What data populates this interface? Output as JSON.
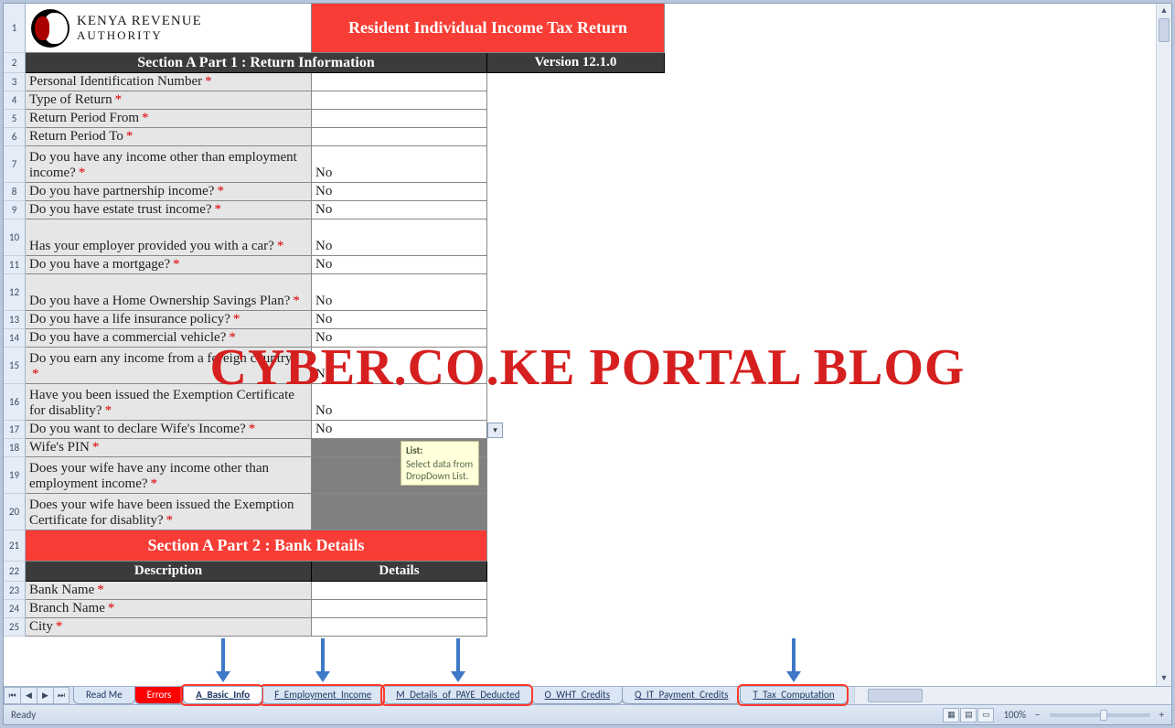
{
  "logo": {
    "line1": "KENYA REVENUE",
    "line2": "AUTHORITY"
  },
  "title": "Resident Individual Income Tax Return",
  "sectionA1": "Section A Part 1 : Return Information",
  "version": "Version 12.1.0",
  "rows": [
    {
      "n": 3,
      "label": "Personal Identification Number",
      "req": true,
      "val": "",
      "h": 20
    },
    {
      "n": 4,
      "label": "Type of Return",
      "req": true,
      "val": "",
      "h": 20
    },
    {
      "n": 5,
      "label": "Return Period From",
      "req": true,
      "val": "",
      "h": 20
    },
    {
      "n": 6,
      "label": "Return Period To",
      "req": true,
      "val": "",
      "h": 20
    },
    {
      "n": 7,
      "label": "Do you have any income other than employment income?",
      "req": true,
      "val": "No",
      "h": 40
    },
    {
      "n": 8,
      "label": "Do you have partnership income?",
      "req": true,
      "val": "No",
      "h": 20
    },
    {
      "n": 9,
      "label": "Do you have estate trust income?",
      "req": true,
      "val": "No",
      "h": 20
    },
    {
      "n": 10,
      "label": "Has your employer provided you with a car?",
      "req": true,
      "val": "No",
      "h": 40
    },
    {
      "n": 11,
      "label": "Do you have a mortgage?",
      "req": true,
      "val": "No",
      "h": 20
    },
    {
      "n": 12,
      "label": "Do you have a Home Ownership Savings Plan?",
      "req": true,
      "val": "No",
      "h": 40
    },
    {
      "n": 13,
      "label": "Do you have a life insurance policy?",
      "req": true,
      "val": "No",
      "h": 20
    },
    {
      "n": 14,
      "label": "Do you have a commercial vehicle?",
      "req": true,
      "val": "No",
      "h": 20
    },
    {
      "n": 15,
      "label": "Do you earn any income from a foreign country?",
      "req": true,
      "val": "No",
      "h": 40
    },
    {
      "n": 16,
      "label": "Have you been issued the Exemption Certificate for disablity?",
      "req": true,
      "val": "No",
      "h": 40
    },
    {
      "n": 17,
      "label": "Do you want to declare Wife's Income?",
      "req": true,
      "val": "No",
      "h": 20,
      "dd": true
    },
    {
      "n": 18,
      "label": "Wife's PIN",
      "req": true,
      "val": "",
      "h": 20,
      "grey": true
    },
    {
      "n": 19,
      "label": "Does your wife have any income other than employment income?",
      "req": true,
      "val": "",
      "h": 40,
      "grey": true
    },
    {
      "n": 20,
      "label": "Does your wife have been issued the Exemption Certificate for disablity?",
      "req": true,
      "val": "",
      "h": 40,
      "grey": true
    }
  ],
  "sectionA2": "Section A Part 2 : Bank Details",
  "subhdr": {
    "desc": "Description",
    "det": "Details"
  },
  "bankRows": [
    {
      "n": 23,
      "label": "Bank Name",
      "req": true
    },
    {
      "n": 24,
      "label": "Branch Name",
      "req": true
    },
    {
      "n": 25,
      "label": "City",
      "req": true
    }
  ],
  "tooltip": {
    "title": "List:",
    "body": "Select data from DropDown List."
  },
  "tabs": [
    {
      "label": "Read Me"
    },
    {
      "label": "Errors",
      "errors": true
    },
    {
      "label": "A_Basic_Info",
      "active": true,
      "ul": true,
      "hl": true
    },
    {
      "label": "F_Employment_Income",
      "ul": true,
      "hl": true
    },
    {
      "label": "M_Details_of_PAYE_Deducted",
      "ul": true,
      "hl": true
    },
    {
      "label": "O_WHT_Credits",
      "ul": true
    },
    {
      "label": "Q_IT_Payment_Credits",
      "ul": true
    },
    {
      "label": "T_Tax_Computation",
      "ul": true,
      "hl": true
    }
  ],
  "status": {
    "ready": "Ready",
    "zoom": "100%"
  },
  "watermark": "CYBER.CO.KE PORTAL BLOG"
}
